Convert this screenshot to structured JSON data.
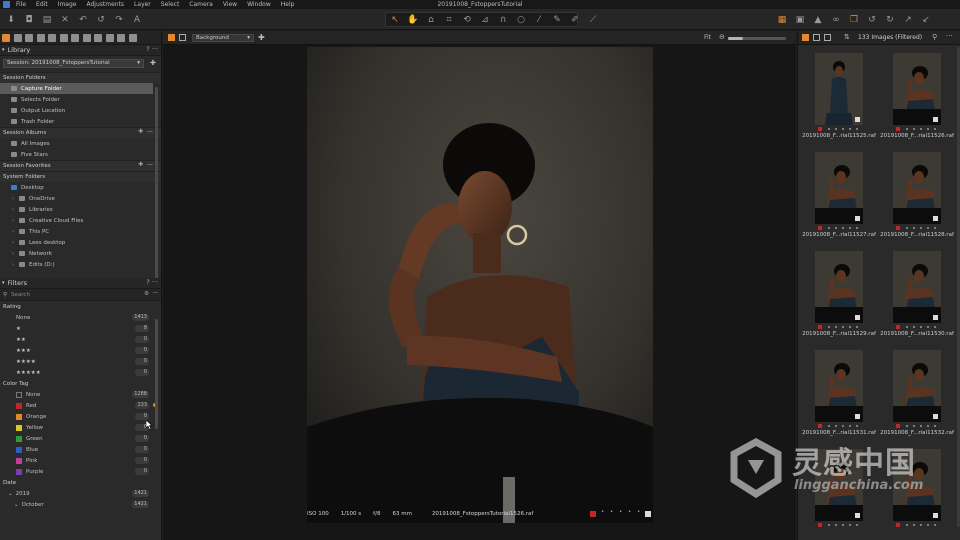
{
  "window": {
    "title": "20191008_FstoppersTutorial"
  },
  "menu": [
    "File",
    "Edit",
    "Image",
    "Adjustments",
    "Layer",
    "Select",
    "Camera",
    "View",
    "Window",
    "Help"
  ],
  "toolbar": {
    "left_icons": [
      "import-icon",
      "camera-icon",
      "open-folder-icon",
      "close-icon",
      "undo-icon",
      "redo-left-icon",
      "redo-icon",
      "text-icon"
    ],
    "center_tools": [
      "pointer-icon",
      "pan-icon",
      "stamp-icon",
      "crop-icon",
      "rotate-icon",
      "keystone-icon",
      "lasso-icon",
      "circle-icon",
      "picker-icon",
      "brush-icon",
      "eraser-icon",
      "gradient-icon"
    ],
    "right_icons": [
      "grid-on-icon",
      "compare-icon",
      "warning-icon",
      "glasses-icon",
      "copy-adjust-icon",
      "rotate-left-icon",
      "rotate-right-icon",
      "apply-icon",
      "reset-icon"
    ]
  },
  "library": {
    "header": "Library",
    "help": "?",
    "menu": "···",
    "session": "Session: 20191008_FstoppersTutorial",
    "session_folders_title": "Session Folders",
    "session_folders": [
      {
        "label": "Capture Folder",
        "selected": true
      },
      {
        "label": "Selects Folder",
        "selected": false
      },
      {
        "label": "Output Location",
        "selected": false
      },
      {
        "label": "Trash Folder",
        "selected": false
      }
    ],
    "session_albums_title": "Session Albums",
    "session_albums": [
      "All Images",
      "Five Stars"
    ],
    "session_favorites_title": "Session Favorites",
    "system_folders_title": "System Folders",
    "system_root": "Desktop",
    "system_folders": [
      "OneDrive",
      "Libraries",
      "Creative Cloud Files",
      "This PC",
      "Lees desktop",
      "Network",
      "Edits (D:)"
    ]
  },
  "filters": {
    "header": "Filters",
    "help": "?",
    "menu": "···",
    "search_placeholder": "Search",
    "rating_title": "Rating",
    "ratings": [
      {
        "label": "None",
        "count": "1413"
      },
      {
        "label": "★",
        "count": "8"
      },
      {
        "label": "★★",
        "count": "0"
      },
      {
        "label": "★★★",
        "count": "0"
      },
      {
        "label": "★★★★",
        "count": "0"
      },
      {
        "label": "★★★★★",
        "count": "0"
      }
    ],
    "color_tag_title": "Color Tag",
    "color_tags": [
      {
        "label": "None",
        "count": "1288",
        "color": "#2a2a2a"
      },
      {
        "label": "Red",
        "count": "133",
        "color": "#c0262a"
      },
      {
        "label": "Orange",
        "count": "0",
        "color": "#e0892a"
      },
      {
        "label": "Yellow",
        "count": "0",
        "color": "#d7c62c"
      },
      {
        "label": "Green",
        "count": "0",
        "color": "#2e9e3b"
      },
      {
        "label": "Blue",
        "count": "0",
        "color": "#2c5fc6"
      },
      {
        "label": "Pink",
        "count": "0",
        "color": "#c23c9a"
      },
      {
        "label": "Purple",
        "count": "0",
        "color": "#7d3bb5"
      }
    ],
    "date_title": "Date",
    "dates": [
      {
        "label": "2019",
        "count": "1421"
      },
      {
        "label": "October",
        "count": "1421"
      }
    ]
  },
  "viewer": {
    "background_label": "Background",
    "fit_label": "Fit",
    "zoom_level": 0.25,
    "status": {
      "iso": "ISO 100",
      "shutter": "1/100 s",
      "aperture": "f/8",
      "focal": "63 mm",
      "filename": "20191008_FstoppersTutorial1526.raf"
    }
  },
  "browser": {
    "count_label": "133 Images (Filtered)",
    "thumbnails": [
      {
        "caption": "20191008_F...rial11525.raf",
        "pose": "standing"
      },
      {
        "caption": "20191008_F...rial11526.raf",
        "pose": "seated"
      },
      {
        "caption": "20191008_F...rial11527.raf",
        "pose": "seated"
      },
      {
        "caption": "20191008_F...rial11528.raf",
        "pose": "seated"
      },
      {
        "caption": "20191008_F...rial11529.raf",
        "pose": "seated"
      },
      {
        "caption": "20191008_F...rial11530.raf",
        "pose": "seated"
      },
      {
        "caption": "20191008_F...rial11531.raf",
        "pose": "seated"
      },
      {
        "caption": "20191008_F...rial11532.raf",
        "pose": "seated"
      },
      {
        "caption": "",
        "pose": "seated"
      },
      {
        "caption": "",
        "pose": "seated"
      }
    ]
  },
  "watermark": {
    "chinese": "灵感中国",
    "latin": "lingganchina.com"
  },
  "colors": {
    "accent": "#e08a2c",
    "selection": "#5b5b5b",
    "tag_red": "#c0262a"
  }
}
